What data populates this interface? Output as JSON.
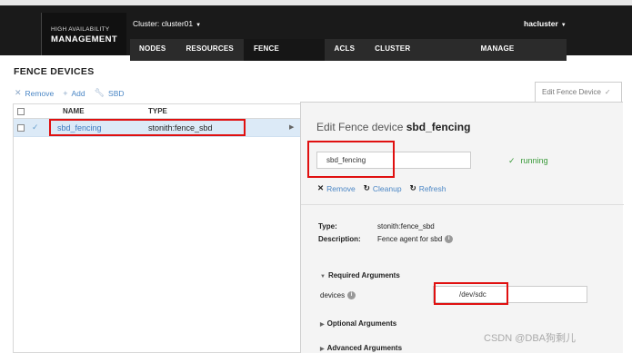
{
  "header": {
    "brand_line1": "HIGH AVAILABILITY",
    "brand_line2": "MANAGEMENT",
    "cluster_selector": "Cluster: cluster01",
    "user_menu": "hacluster",
    "nav": [
      {
        "label": "NODES",
        "active": false
      },
      {
        "label": "RESOURCES",
        "active": false
      },
      {
        "label": "FENCE DEVICES",
        "active": true
      },
      {
        "label": "ACLS",
        "active": false
      },
      {
        "label": "CLUSTER PROPERTIES",
        "active": false
      },
      {
        "label": "MANAGE CLUSTERS",
        "active": false
      }
    ]
  },
  "page_title": "FENCE DEVICES",
  "toolbar": {
    "remove_label": "Remove",
    "add_label": "Add",
    "sbd_label": "SBD"
  },
  "table": {
    "columns": [
      "NAME",
      "TYPE"
    ],
    "rows": [
      {
        "name": "sbd_fencing",
        "type": "stonith:fence_sbd",
        "selected": true
      }
    ]
  },
  "edit_tab_label": "Edit Fence Device",
  "edit_panel": {
    "title_prefix": "Edit Fence device",
    "title_name": "sbd_fencing",
    "name_value": "sbd_fencing",
    "status": "running",
    "actions": {
      "remove_label": "Remove",
      "cleanup_label": "Cleanup",
      "refresh_label": "Refresh"
    },
    "type_label": "Type:",
    "type_value": "stonith:fence_sbd",
    "description_label": "Description:",
    "description_value": "Fence agent for sbd",
    "required_args_label": "Required Arguments",
    "devices_label": "devices",
    "devices_value": "/dev/sdc",
    "optional_args_label": "Optional Arguments",
    "advanced_args_label": "Advanced Arguments"
  },
  "watermark": "CSDN @DBA狗剩儿",
  "colors": {
    "accent_link": "#4a86c5",
    "running_green": "#3a9a3a",
    "annotation_red": "#e01010",
    "header_bg": "#1a1a1a"
  }
}
